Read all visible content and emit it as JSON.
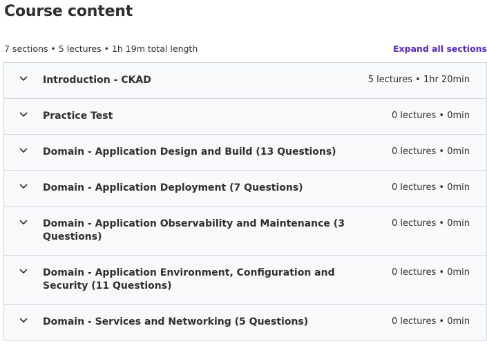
{
  "page_title": "Course content",
  "summary": "7 sections • 5 lectures • 1h 19m total length",
  "expand_all_label": "Expand all sections",
  "sections": [
    {
      "title": "Introduction - CKAD",
      "meta": "5 lectures • 1hr 20min"
    },
    {
      "title": "Practice Test",
      "meta": "0 lectures • 0min"
    },
    {
      "title": "Domain - Application Design and Build (13 Questions)",
      "meta": "0 lectures • 0min"
    },
    {
      "title": "Domain - Application Deployment (7 Questions)",
      "meta": "0 lectures • 0min"
    },
    {
      "title": "Domain - Application Observability and Maintenance (3 Questions)",
      "meta": "0 lectures • 0min"
    },
    {
      "title": "Domain - Application Environment, Configuration and Security (11 Questions)",
      "meta": "0 lectures • 0min"
    },
    {
      "title": "Domain - Services and Networking (5 Questions)",
      "meta": "0 lectures • 0min"
    }
  ],
  "icons": {
    "section_toggle": "chevron-down-icon"
  },
  "colors": {
    "accent": "#5624d0",
    "text": "#2d2f31",
    "section_bg": "#f7f9fa",
    "border": "#d1d7dc"
  }
}
